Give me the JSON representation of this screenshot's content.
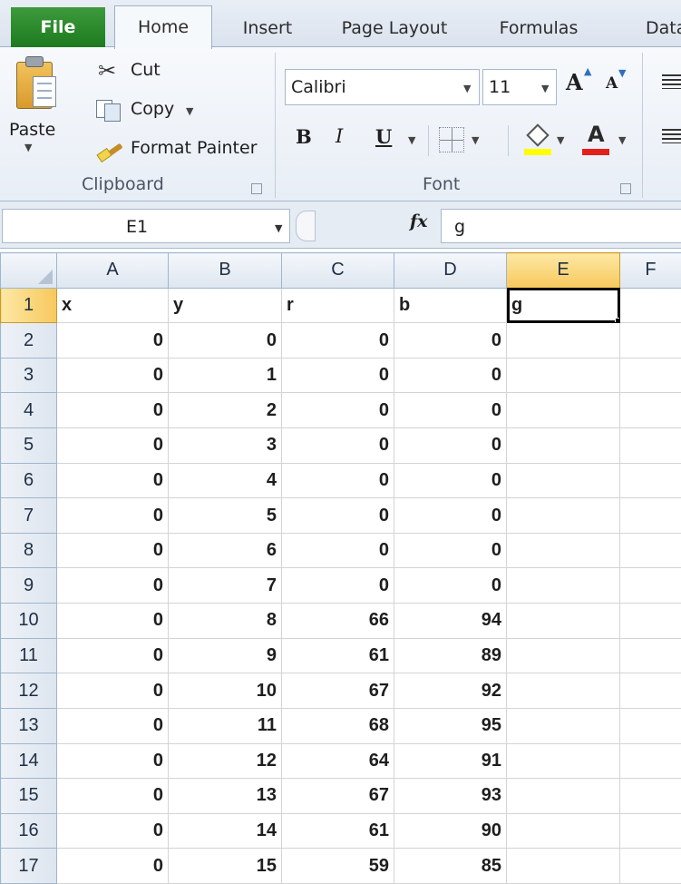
{
  "tabs": {
    "file": "File",
    "home": "Home",
    "insert": "Insert",
    "page_layout": "Page Layout",
    "formulas": "Formulas",
    "data": "Data"
  },
  "clipboard": {
    "paste": "Paste",
    "cut": "Cut",
    "copy": "Copy",
    "format_painter": "Format Painter",
    "group_label": "Clipboard"
  },
  "font": {
    "name": "Calibri",
    "size": "11",
    "group_label": "Font",
    "bold": "B",
    "italic": "I",
    "underline": "U",
    "font_color_letter": "A",
    "fill_color": "#ffff00",
    "font_color": "#e3201b"
  },
  "formula_bar": {
    "name_box": "E1",
    "fx": "fx",
    "value": "g"
  },
  "sheet": {
    "columns": [
      "A",
      "B",
      "C",
      "D",
      "E",
      "F"
    ],
    "active_column": "E",
    "active_row": "1",
    "active_cell": "E1",
    "rows": [
      {
        "n": "1",
        "cells": [
          "x",
          "y",
          "r",
          "b",
          "g",
          ""
        ]
      },
      {
        "n": "2",
        "cells": [
          "0",
          "0",
          "0",
          "0",
          "",
          ""
        ]
      },
      {
        "n": "3",
        "cells": [
          "0",
          "1",
          "0",
          "0",
          "",
          ""
        ]
      },
      {
        "n": "4",
        "cells": [
          "0",
          "2",
          "0",
          "0",
          "",
          ""
        ]
      },
      {
        "n": "5",
        "cells": [
          "0",
          "3",
          "0",
          "0",
          "",
          ""
        ]
      },
      {
        "n": "6",
        "cells": [
          "0",
          "4",
          "0",
          "0",
          "",
          ""
        ]
      },
      {
        "n": "7",
        "cells": [
          "0",
          "5",
          "0",
          "0",
          "",
          ""
        ]
      },
      {
        "n": "8",
        "cells": [
          "0",
          "6",
          "0",
          "0",
          "",
          ""
        ]
      },
      {
        "n": "9",
        "cells": [
          "0",
          "7",
          "0",
          "0",
          "",
          ""
        ]
      },
      {
        "n": "10",
        "cells": [
          "0",
          "8",
          "66",
          "94",
          "",
          ""
        ]
      },
      {
        "n": "11",
        "cells": [
          "0",
          "9",
          "61",
          "89",
          "",
          ""
        ]
      },
      {
        "n": "12",
        "cells": [
          "0",
          "10",
          "67",
          "92",
          "",
          ""
        ]
      },
      {
        "n": "13",
        "cells": [
          "0",
          "11",
          "68",
          "95",
          "",
          ""
        ]
      },
      {
        "n": "14",
        "cells": [
          "0",
          "12",
          "64",
          "91",
          "",
          ""
        ]
      },
      {
        "n": "15",
        "cells": [
          "0",
          "13",
          "67",
          "93",
          "",
          ""
        ]
      },
      {
        "n": "16",
        "cells": [
          "0",
          "14",
          "61",
          "90",
          "",
          ""
        ]
      },
      {
        "n": "17",
        "cells": [
          "0",
          "15",
          "59",
          "85",
          "",
          ""
        ]
      }
    ]
  }
}
